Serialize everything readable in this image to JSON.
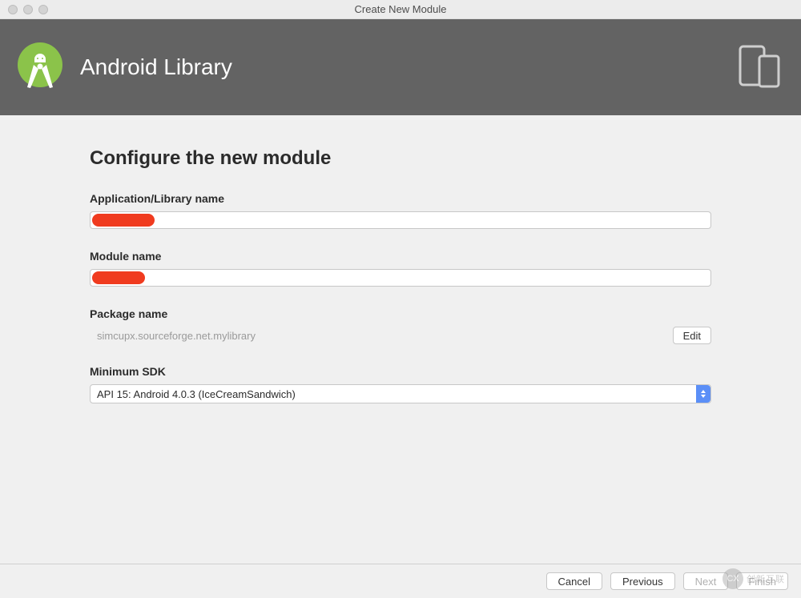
{
  "window": {
    "title": "Create New Module"
  },
  "header": {
    "title": "Android Library"
  },
  "content": {
    "heading": "Configure the new module",
    "fields": {
      "app_library_name": {
        "label": "Application/Library name",
        "value": ""
      },
      "module_name": {
        "label": "Module name",
        "value": ""
      },
      "package_name": {
        "label": "Package name",
        "value": "simcupx.sourceforge.net.mylibrary",
        "edit_label": "Edit"
      },
      "minimum_sdk": {
        "label": "Minimum SDK",
        "selected": "API 15: Android 4.0.3 (IceCreamSandwich)"
      }
    }
  },
  "footer": {
    "cancel": "Cancel",
    "previous": "Previous",
    "next": "Next",
    "finish": "Finish"
  },
  "watermark": {
    "text": "创新互联"
  }
}
